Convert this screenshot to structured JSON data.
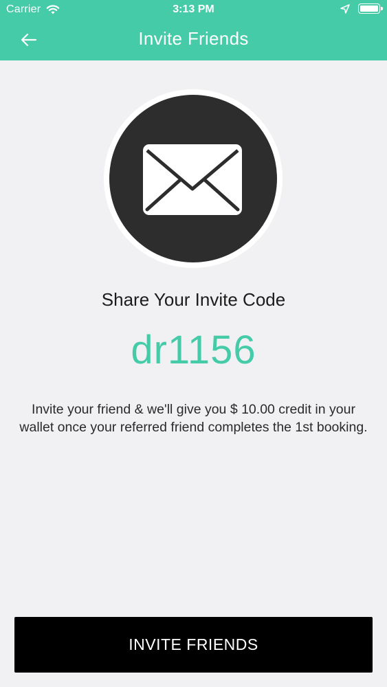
{
  "status_bar": {
    "carrier": "Carrier",
    "time": "3:13 PM"
  },
  "nav": {
    "title": "Invite Friends",
    "back_icon": "arrow-left-icon"
  },
  "hero": {
    "icon": "envelope-icon"
  },
  "content": {
    "share_title": "Share Your Invite Code",
    "invite_code": "dr1156",
    "description": "Invite your friend & we'll give you $ 10.00 credit in your wallet once your referred friend completes the 1st booking."
  },
  "actions": {
    "invite_button_label": "INVITE FRIENDS"
  },
  "colors": {
    "accent": "#45cba8",
    "circle": "#2d2d2d",
    "background": "#f1f1f3",
    "button": "#000000"
  }
}
